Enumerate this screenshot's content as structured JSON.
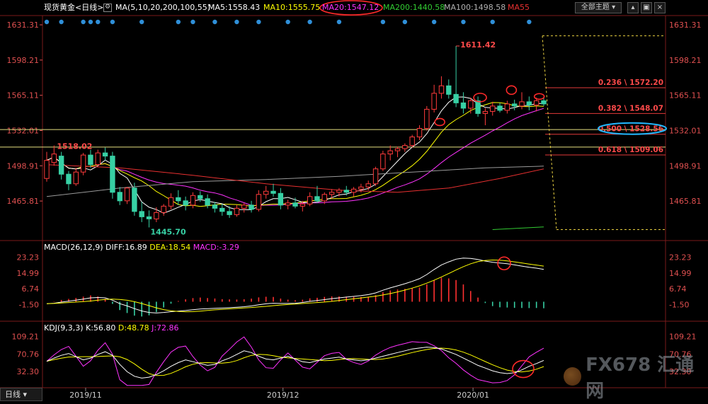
{
  "header": {
    "instrument": "现货黄金<日线>",
    "ma_params": "MA(5,10,20,200,100,55)",
    "ma5": "MA5:1558.43",
    "ma10": "MA10:1555.75",
    "ma20": "MA20:1547.12",
    "ma200": "MA200:1440.58",
    "ma100": "MA100:1498.58",
    "ma55": "MA55",
    "theme_button": "全部主题"
  },
  "colors": {
    "up_candle": "#ff3b3b",
    "down_candle": "#37d0a4",
    "ma5": "#ffffff",
    "ma10": "#ffff00",
    "ma20": "#ff33ff",
    "ma100": "#9a9a9a",
    "ma55": "#e83030",
    "ma200": "#33cc33",
    "hline": "#e8e080",
    "axis_text": "#e05050",
    "dot": "#2f8fd8"
  },
  "chart_data": [
    {
      "type": "candlestick",
      "title": "现货黄金 日线",
      "ylim": [
        1430,
        1640
      ],
      "y_ticks": [
        "1631.31",
        "1598.21",
        "1565.11",
        "1532.01",
        "1498.91",
        "1465.81"
      ],
      "x_labels": [
        "2019/11",
        "2019/12",
        "2020/01"
      ],
      "annotations": {
        "high": "1611.42",
        "low": "1445.70",
        "peak": "1518.02"
      },
      "candles": [
        {
          "o": 1487,
          "h": 1512,
          "l": 1484,
          "c": 1504
        },
        {
          "o": 1502,
          "h": 1518,
          "l": 1499,
          "c": 1510
        },
        {
          "o": 1508,
          "h": 1512,
          "l": 1486,
          "c": 1491
        },
        {
          "o": 1491,
          "h": 1494,
          "l": 1476,
          "c": 1482
        },
        {
          "o": 1482,
          "h": 1497,
          "l": 1480,
          "c": 1493
        },
        {
          "o": 1493,
          "h": 1511,
          "l": 1490,
          "c": 1509
        },
        {
          "o": 1509,
          "h": 1514,
          "l": 1497,
          "c": 1500
        },
        {
          "o": 1500,
          "h": 1514,
          "l": 1498,
          "c": 1511
        },
        {
          "o": 1511,
          "h": 1516,
          "l": 1504,
          "c": 1508
        },
        {
          "o": 1508,
          "h": 1512,
          "l": 1468,
          "c": 1474
        },
        {
          "o": 1474,
          "h": 1479,
          "l": 1462,
          "c": 1466
        },
        {
          "o": 1466,
          "h": 1479,
          "l": 1463,
          "c": 1478
        },
        {
          "o": 1478,
          "h": 1483,
          "l": 1452,
          "c": 1456
        },
        {
          "o": 1456,
          "h": 1465,
          "l": 1446,
          "c": 1451
        },
        {
          "o": 1451,
          "h": 1457,
          "l": 1445,
          "c": 1449
        },
        {
          "o": 1449,
          "h": 1460,
          "l": 1446,
          "c": 1455
        },
        {
          "o": 1455,
          "h": 1463,
          "l": 1452,
          "c": 1461
        },
        {
          "o": 1461,
          "h": 1473,
          "l": 1458,
          "c": 1469
        },
        {
          "o": 1469,
          "h": 1476,
          "l": 1462,
          "c": 1466
        },
        {
          "o": 1466,
          "h": 1470,
          "l": 1457,
          "c": 1462
        },
        {
          "o": 1462,
          "h": 1474,
          "l": 1459,
          "c": 1471
        },
        {
          "o": 1471,
          "h": 1475,
          "l": 1465,
          "c": 1468
        },
        {
          "o": 1468,
          "h": 1472,
          "l": 1459,
          "c": 1462
        },
        {
          "o": 1462,
          "h": 1465,
          "l": 1455,
          "c": 1459
        },
        {
          "o": 1459,
          "h": 1463,
          "l": 1452,
          "c": 1456
        },
        {
          "o": 1456,
          "h": 1461,
          "l": 1450,
          "c": 1453
        },
        {
          "o": 1453,
          "h": 1462,
          "l": 1451,
          "c": 1459
        },
        {
          "o": 1459,
          "h": 1464,
          "l": 1455,
          "c": 1462
        },
        {
          "o": 1462,
          "h": 1466,
          "l": 1455,
          "c": 1458
        },
        {
          "o": 1458,
          "h": 1476,
          "l": 1456,
          "c": 1472
        },
        {
          "o": 1472,
          "h": 1480,
          "l": 1468,
          "c": 1475
        },
        {
          "o": 1475,
          "h": 1482,
          "l": 1470,
          "c": 1473
        },
        {
          "o": 1473,
          "h": 1478,
          "l": 1458,
          "c": 1462
        },
        {
          "o": 1462,
          "h": 1467,
          "l": 1458,
          "c": 1464
        },
        {
          "o": 1464,
          "h": 1469,
          "l": 1459,
          "c": 1461
        },
        {
          "o": 1461,
          "h": 1466,
          "l": 1456,
          "c": 1463
        },
        {
          "o": 1463,
          "h": 1474,
          "l": 1461,
          "c": 1470
        },
        {
          "o": 1470,
          "h": 1480,
          "l": 1464,
          "c": 1466
        },
        {
          "o": 1466,
          "h": 1474,
          "l": 1463,
          "c": 1472
        },
        {
          "o": 1472,
          "h": 1477,
          "l": 1468,
          "c": 1474
        },
        {
          "o": 1474,
          "h": 1478,
          "l": 1470,
          "c": 1476
        },
        {
          "o": 1476,
          "h": 1480,
          "l": 1471,
          "c": 1474
        },
        {
          "o": 1474,
          "h": 1479,
          "l": 1470,
          "c": 1477
        },
        {
          "o": 1477,
          "h": 1482,
          "l": 1474,
          "c": 1479
        },
        {
          "o": 1479,
          "h": 1485,
          "l": 1476,
          "c": 1482
        },
        {
          "o": 1482,
          "h": 1498,
          "l": 1480,
          "c": 1496
        },
        {
          "o": 1496,
          "h": 1513,
          "l": 1494,
          "c": 1510
        },
        {
          "o": 1510,
          "h": 1518,
          "l": 1504,
          "c": 1513
        },
        {
          "o": 1513,
          "h": 1517,
          "l": 1507,
          "c": 1515
        },
        {
          "o": 1515,
          "h": 1520,
          "l": 1512,
          "c": 1518
        },
        {
          "o": 1518,
          "h": 1528,
          "l": 1516,
          "c": 1526
        },
        {
          "o": 1526,
          "h": 1537,
          "l": 1523,
          "c": 1534
        },
        {
          "o": 1534,
          "h": 1555,
          "l": 1532,
          "c": 1552
        },
        {
          "o": 1552,
          "h": 1575,
          "l": 1549,
          "c": 1567
        },
        {
          "o": 1567,
          "h": 1583,
          "l": 1562,
          "c": 1574
        },
        {
          "o": 1574,
          "h": 1580,
          "l": 1562,
          "c": 1566
        },
        {
          "o": 1566,
          "h": 1611.42,
          "l": 1554,
          "c": 1558
        },
        {
          "o": 1558,
          "h": 1568,
          "l": 1548,
          "c": 1553
        },
        {
          "o": 1553,
          "h": 1563,
          "l": 1548,
          "c": 1560
        },
        {
          "o": 1560,
          "h": 1564,
          "l": 1545,
          "c": 1548
        },
        {
          "o": 1548,
          "h": 1553,
          "l": 1537,
          "c": 1550
        },
        {
          "o": 1550,
          "h": 1559,
          "l": 1546,
          "c": 1555
        },
        {
          "o": 1555,
          "h": 1558,
          "l": 1549,
          "c": 1551
        },
        {
          "o": 1551,
          "h": 1560,
          "l": 1548,
          "c": 1557
        },
        {
          "o": 1557,
          "h": 1561,
          "l": 1551,
          "c": 1555
        },
        {
          "o": 1555,
          "h": 1568,
          "l": 1552,
          "c": 1559
        },
        {
          "o": 1559,
          "h": 1564,
          "l": 1551,
          "c": 1556
        },
        {
          "o": 1556,
          "h": 1563,
          "l": 1550,
          "c": 1560
        },
        {
          "o": 1560,
          "h": 1564,
          "l": 1555,
          "c": 1557
        }
      ],
      "fibonacci": [
        {
          "label": "0.236 \\ 1572.20",
          "value": 1572.2
        },
        {
          "label": "0.382 \\ 1548.07",
          "value": 1548.07
        },
        {
          "label": "0.500 \\ 1528.56",
          "value": 1528.56
        },
        {
          "label": "0.618 \\ 1509.06",
          "value": 1509.06
        }
      ],
      "horizontal_lines": [
        1532.9,
        1516.5
      ]
    },
    {
      "type": "line",
      "title": "MACD(26,12,9) DIFF:16.89 DEA:18.54 MACD:-3.29",
      "ylim": [
        -5,
        26
      ],
      "y_ticks": [
        "23.23",
        "14.99",
        "6.74",
        "-1.50"
      ],
      "series_names": [
        "DIFF",
        "DEA",
        "MACD"
      ],
      "values": {
        "DIFF": "16.89",
        "DEA": "18.54",
        "MACD": "-3.29"
      }
    },
    {
      "type": "line",
      "title": "KDJ(9,3,3) K:56.80 D:48.78 J:72.86",
      "ylim": [
        0,
        118
      ],
      "y_ticks": [
        "109.21",
        "70.76",
        "32.30"
      ],
      "series_names": [
        "K",
        "D",
        "J"
      ],
      "values": {
        "K": "56.80",
        "D": "48.78",
        "J": "72.86"
      }
    }
  ],
  "macd": {
    "label_prefix": "MACD(26,12,9)",
    "diff": "DIFF:16.89",
    "dea": "DEA:18.54",
    "macd": "MACD:-3.29"
  },
  "kdj": {
    "label_prefix": "KDJ(9,3,3)",
    "k": "K:56.80",
    "d": "D:48.78",
    "j": "J:72.86"
  },
  "footer": {
    "period": "日线",
    "watermark": "FX678 汇通网"
  }
}
